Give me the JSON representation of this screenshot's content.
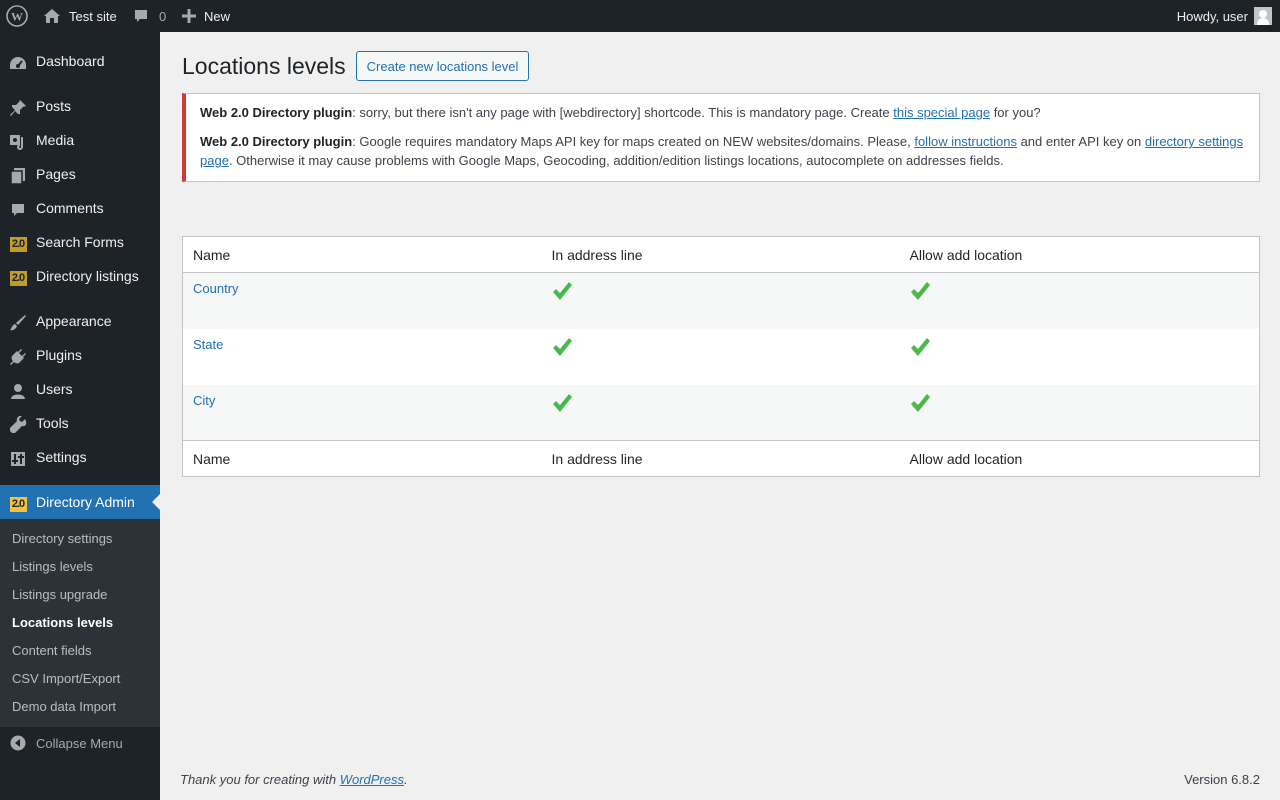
{
  "admin_bar": {
    "site_name": "Test site",
    "comments_count": "0",
    "new_label": "New",
    "howdy": "Howdy, user"
  },
  "sidebar": {
    "items": [
      {
        "label": "Dashboard",
        "icon": "dashboard-icon"
      },
      {
        "label": "Posts",
        "icon": "pin-icon"
      },
      {
        "label": "Media",
        "icon": "media-icon"
      },
      {
        "label": "Pages",
        "icon": "pages-icon"
      },
      {
        "label": "Comments",
        "icon": "comment-icon"
      },
      {
        "label": "Search Forms",
        "icon": "plugin-2-0-icon"
      },
      {
        "label": "Directory listings",
        "icon": "plugin-2-0-icon"
      },
      {
        "label": "Appearance",
        "icon": "brush-icon"
      },
      {
        "label": "Plugins",
        "icon": "plug-icon"
      },
      {
        "label": "Users",
        "icon": "user-icon"
      },
      {
        "label": "Tools",
        "icon": "wrench-icon"
      },
      {
        "label": "Settings",
        "icon": "settings-icon"
      },
      {
        "label": "Directory Admin",
        "icon": "plugin-2-0-icon"
      }
    ],
    "badge_text": "2.0",
    "submenu": [
      "Directory settings",
      "Listings levels",
      "Listings upgrade",
      "Locations levels",
      "Content fields",
      "CSV Import/Export",
      "Demo data Import"
    ],
    "collapse_label": "Collapse Menu"
  },
  "page": {
    "title": "Locations levels",
    "create_button": "Create new locations level"
  },
  "notice": {
    "n1_strong": "Web 2.0 Directory plugin",
    "n1_text": ": sorry, but there isn't any page with [webdirectory] shortcode. This is mandatory page. Create ",
    "n1_link": "this special page",
    "n1_end": " for you?",
    "n2_strong": "Web 2.0 Directory plugin",
    "n2_text": ": Google requires mandatory Maps API key for maps created on NEW websites/domains. Please, ",
    "n2_link1": "follow instructions",
    "n2_mid": " and enter API key on ",
    "n2_link2": "directory settings page",
    "n2_end": ". Otherwise it may cause problems with Google Maps, Geocoding, addition/edition listings locations, autocomplete on addresses fields."
  },
  "table": {
    "columns": [
      "Name",
      "In address line",
      "Allow add location"
    ],
    "rows": [
      {
        "name": "Country",
        "in_address_line": true,
        "allow_add_location": true
      },
      {
        "name": "State",
        "in_address_line": true,
        "allow_add_location": true
      },
      {
        "name": "City",
        "in_address_line": true,
        "allow_add_location": true
      }
    ],
    "check_color": "#4ab84a"
  },
  "footer": {
    "thanks_prefix": "Thank you for creating with ",
    "thanks_link": "WordPress",
    "thanks_suffix": ".",
    "version": "Version 6.8.2"
  },
  "colors": {
    "accent": "#2271b1",
    "sidebar_bg": "#1d2327",
    "notice_error": "#d63638"
  }
}
